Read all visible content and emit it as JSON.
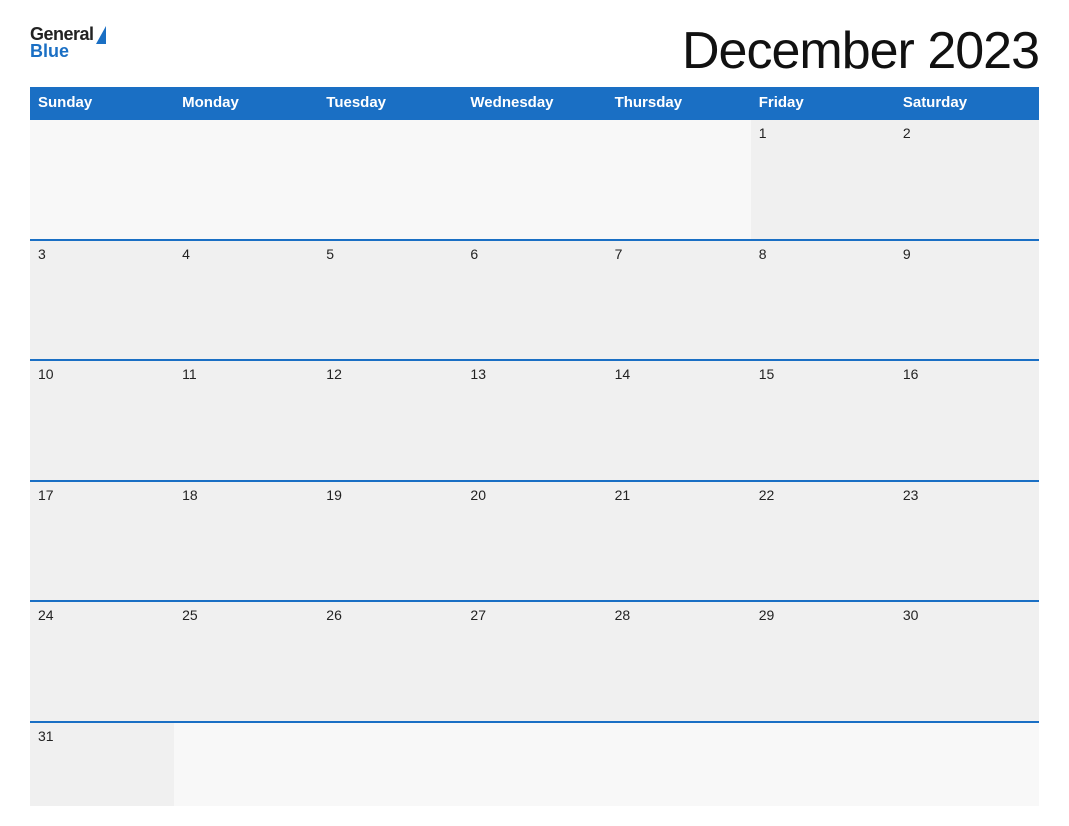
{
  "logo": {
    "general": "General",
    "blue": "Blue",
    "triangle_color": "#1a6fc4"
  },
  "title": "December 2023",
  "header_color": "#1a6fc4",
  "days": {
    "headers": [
      "Sunday",
      "Monday",
      "Tuesday",
      "Wednesday",
      "Thursday",
      "Friday",
      "Saturday"
    ]
  },
  "weeks": [
    {
      "cells": [
        {
          "num": "",
          "empty": true
        },
        {
          "num": "",
          "empty": true
        },
        {
          "num": "",
          "empty": true
        },
        {
          "num": "",
          "empty": true
        },
        {
          "num": "",
          "empty": true
        },
        {
          "num": "1",
          "empty": false
        },
        {
          "num": "2",
          "empty": false
        }
      ]
    },
    {
      "cells": [
        {
          "num": "3",
          "empty": false
        },
        {
          "num": "4",
          "empty": false
        },
        {
          "num": "5",
          "empty": false
        },
        {
          "num": "6",
          "empty": false
        },
        {
          "num": "7",
          "empty": false
        },
        {
          "num": "8",
          "empty": false
        },
        {
          "num": "9",
          "empty": false
        }
      ]
    },
    {
      "cells": [
        {
          "num": "10",
          "empty": false
        },
        {
          "num": "11",
          "empty": false
        },
        {
          "num": "12",
          "empty": false
        },
        {
          "num": "13",
          "empty": false
        },
        {
          "num": "14",
          "empty": false
        },
        {
          "num": "15",
          "empty": false
        },
        {
          "num": "16",
          "empty": false
        }
      ]
    },
    {
      "cells": [
        {
          "num": "17",
          "empty": false
        },
        {
          "num": "18",
          "empty": false
        },
        {
          "num": "19",
          "empty": false
        },
        {
          "num": "20",
          "empty": false
        },
        {
          "num": "21",
          "empty": false
        },
        {
          "num": "22",
          "empty": false
        },
        {
          "num": "23",
          "empty": false
        }
      ]
    },
    {
      "cells": [
        {
          "num": "24",
          "empty": false
        },
        {
          "num": "25",
          "empty": false
        },
        {
          "num": "26",
          "empty": false
        },
        {
          "num": "27",
          "empty": false
        },
        {
          "num": "28",
          "empty": false
        },
        {
          "num": "29",
          "empty": false
        },
        {
          "num": "30",
          "empty": false
        }
      ]
    },
    {
      "cells": [
        {
          "num": "31",
          "empty": false
        },
        {
          "num": "",
          "empty": true
        },
        {
          "num": "",
          "empty": true
        },
        {
          "num": "",
          "empty": true
        },
        {
          "num": "",
          "empty": true
        },
        {
          "num": "",
          "empty": true
        },
        {
          "num": "",
          "empty": true
        }
      ]
    }
  ]
}
